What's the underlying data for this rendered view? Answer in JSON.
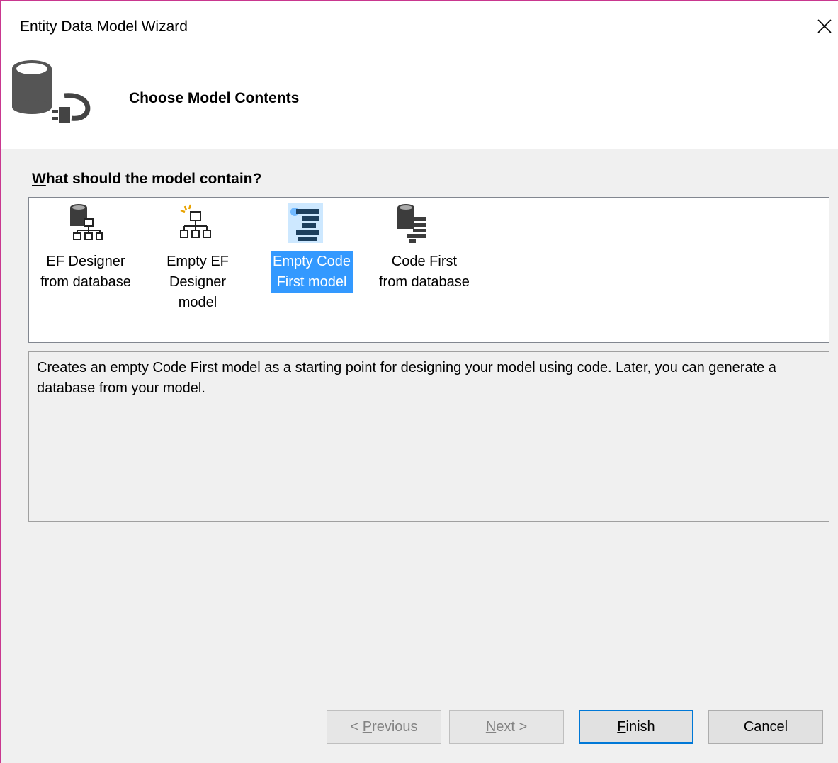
{
  "window": {
    "title": "Entity Data Model Wizard"
  },
  "header": {
    "title": "Choose Model Contents"
  },
  "question": {
    "label_underlined": "W",
    "label_rest": "hat should the model contain?"
  },
  "options": [
    {
      "label": "EF Designer\nfrom database",
      "icon": "database-hierarchy-icon",
      "selected": false
    },
    {
      "label": "Empty EF\nDesigner\nmodel",
      "icon": "new-hierarchy-icon",
      "selected": false
    },
    {
      "label": "Empty Code\nFirst model",
      "icon": "code-first-icon",
      "selected": true
    },
    {
      "label": "Code First\nfrom database",
      "icon": "database-code-icon",
      "selected": false
    }
  ],
  "description": "Creates an empty Code First model as a starting point for designing your model using code. Later, you can generate a database from your model.",
  "buttons": {
    "previous": {
      "prefix": "< ",
      "accel": "P",
      "rest": "revious",
      "enabled": false
    },
    "next": {
      "accel": "N",
      "rest": "ext >",
      "enabled": false
    },
    "finish": {
      "accel": "F",
      "rest": "inish",
      "enabled": true
    },
    "cancel": {
      "label": "Cancel",
      "enabled": true
    }
  },
  "colors": {
    "selection": "#3399ff",
    "accent": "#0078d7",
    "frame": "#c9378f"
  }
}
